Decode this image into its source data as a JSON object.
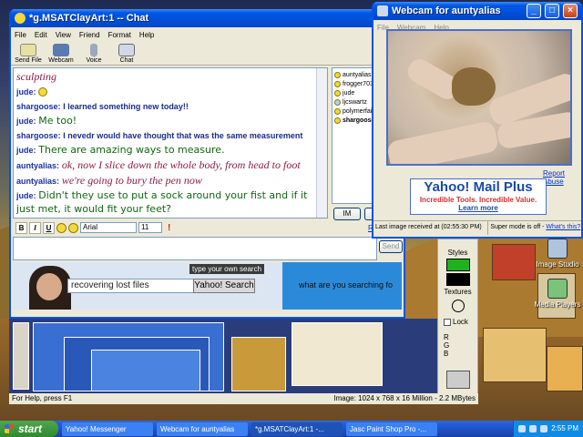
{
  "chat": {
    "title": "*g.MSATClayArt:1 -- Chat",
    "menu": [
      "File",
      "Edit",
      "View",
      "Friend",
      "Format",
      "Help"
    ],
    "toolbar": [
      "Send File",
      "Webcam",
      "Voice",
      "Chat"
    ],
    "messages": [
      {
        "who": "",
        "text": "sculpting",
        "style": "cur"
      },
      {
        "who": "jude:",
        "text": "",
        "style": "smiley"
      },
      {
        "who": "shargoose:",
        "text": "I learned something new today!!",
        "style": "sans"
      },
      {
        "who": "jude:",
        "text": "Me too!",
        "style": "ser"
      },
      {
        "who": "shargoose:",
        "text": "I nevedr would have thought that was the same measurement",
        "style": "sans"
      },
      {
        "who": "jude:",
        "text": "There are amazing ways to measure.",
        "style": "ser"
      },
      {
        "who": "auntyalias:",
        "text": "ok, now I slice down the whole body, from head to foot",
        "style": "cur"
      },
      {
        "who": "auntyalias:",
        "text": "we're going to bury the pen now",
        "style": "cur"
      },
      {
        "who": "jude:",
        "text": "Didn't they use to put a sock around your fist and if it just met, it would fit your feet?",
        "style": "ser"
      }
    ],
    "roster": [
      "auntyalias",
      "frogger703",
      "jude",
      "ljcswartz",
      "polymerfair",
      "shargoose"
    ],
    "im_button": "IM",
    "ig_button": "Ig",
    "re_link": "Re",
    "format": {
      "bold": "B",
      "italic": "I",
      "underline": "U",
      "font": "Arial",
      "size": "11"
    },
    "send_label": "Send"
  },
  "ad": {
    "tip": "type your own search",
    "search_value": "recovering lost files",
    "search_button": "Yahoo! Search",
    "right_text": "what are you searching fo"
  },
  "webcam": {
    "title": "Webcam for auntyalias",
    "menu": [
      "File",
      "Webcam",
      "Help"
    ],
    "report_abuse": "Report Abuse",
    "ad_headline": "Yahoo! Mail Plus",
    "ad_sub": "Incredible Tools. Incredible Value.",
    "ad_link": "Learn more",
    "last_image": "Last image received at (02:55:30 PM)",
    "super_mode": "Super mode is off -",
    "whats_this": "What's this?"
  },
  "psp": {
    "styles_label": "Styles",
    "textures_label": "Textures",
    "lock_label": "Lock",
    "rgb": [
      "R",
      "G",
      "B"
    ],
    "status_left": "For Help, press F1",
    "status_right": "Image:  1024 x 768 x 16 Million - 2.2 MBytes"
  },
  "desktop": {
    "icons": [
      "Image Studio",
      "Media Players"
    ]
  },
  "taskbar": {
    "start": "start",
    "tasks": [
      "Yahoo! Messenger",
      "Webcam for auntyalias",
      "*g.MSATClayArt:1 -...",
      "Jasc Paint Shop Pro -..."
    ],
    "clock": "2:55 PM"
  },
  "colors": {
    "xp_blue": "#0054e3",
    "chat_name": "#1c2fa0",
    "chat_green": "#116611",
    "chat_maroon": "#8e1a45"
  }
}
